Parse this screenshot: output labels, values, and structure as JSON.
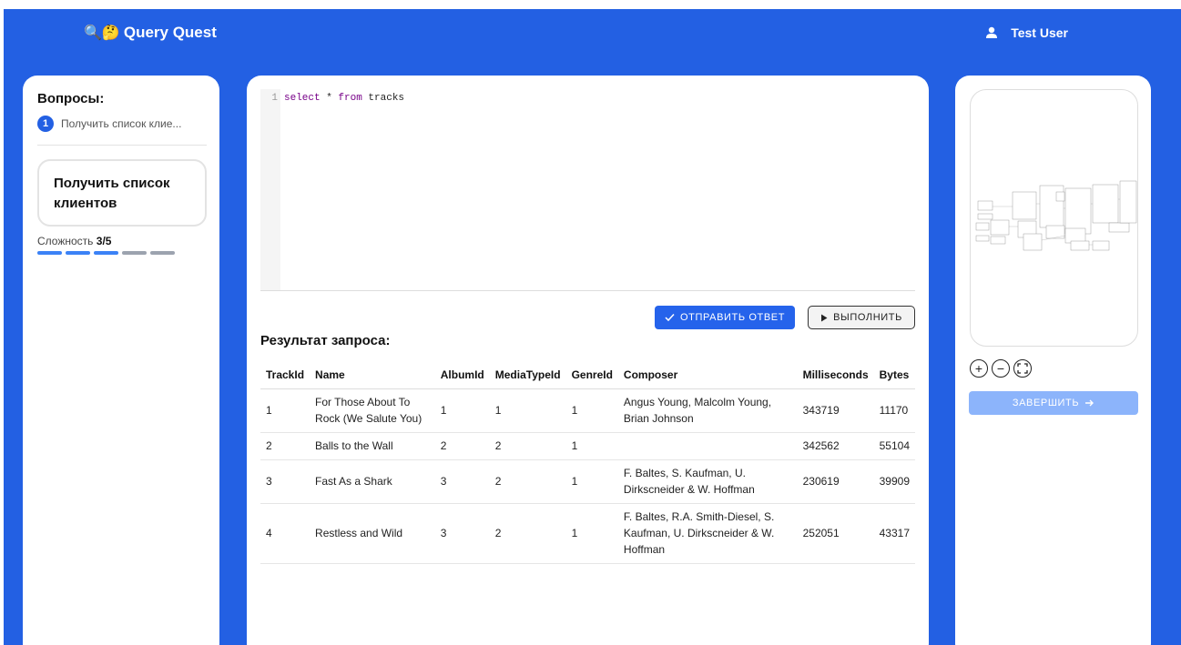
{
  "header": {
    "app_title": "Query Quest",
    "logo_emojis": "🔍🤔",
    "user_name": "Test User"
  },
  "sidebar": {
    "title": "Вопросы:",
    "questions": [
      {
        "number": "1",
        "label": "Получить список клие..."
      }
    ],
    "current_question": "Получить список клиентов",
    "difficulty_label": "Сложность",
    "difficulty_value": "3/5",
    "difficulty_level": 3,
    "difficulty_max": 5
  },
  "editor": {
    "line_number": "1",
    "code_keyword_1": "select",
    "code_mid": " * ",
    "code_keyword_2": "from",
    "code_rest": " tracks"
  },
  "actions": {
    "submit_label": "ОТПРАВИТЬ ОТВЕТ",
    "run_label": "ВЫПОЛНИТЬ",
    "finish_label": "ЗАВЕРШИТЬ"
  },
  "results": {
    "title": "Результат запроса:",
    "columns": [
      "TrackId",
      "Name",
      "AlbumId",
      "MediaTypeId",
      "GenreId",
      "Composer",
      "Milliseconds",
      "Bytes"
    ],
    "rows": [
      [
        "1",
        "For Those About To Rock (We Salute You)",
        "1",
        "1",
        "1",
        "Angus Young, Malcolm Young, Brian Johnson",
        "343719",
        "11170"
      ],
      [
        "2",
        "Balls to the Wall",
        "2",
        "2",
        "1",
        "",
        "342562",
        "55104"
      ],
      [
        "3",
        "Fast As a Shark",
        "3",
        "2",
        "1",
        "F. Baltes, S. Kaufman, U. Dirkscneider & W. Hoffman",
        "230619",
        "39909"
      ],
      [
        "4",
        "Restless and Wild",
        "3",
        "2",
        "1",
        "F. Baltes, R.A. Smith-Diesel, S. Kaufman, U. Dirkscneider & W. Hoffman",
        "252051",
        "43317"
      ]
    ]
  },
  "colors": {
    "brand_blue": "#2360e3",
    "button_blue": "#2563eb",
    "disabled_blue": "#8cb4fb",
    "keyword_purple": "#770088"
  },
  "icons": {
    "user": "user-icon",
    "check": "check-icon",
    "play": "play-icon",
    "arrow": "arrow-right-icon",
    "zoom_in": "zoom-in-icon",
    "zoom_out": "zoom-out-icon",
    "fit": "fit-screen-icon"
  }
}
